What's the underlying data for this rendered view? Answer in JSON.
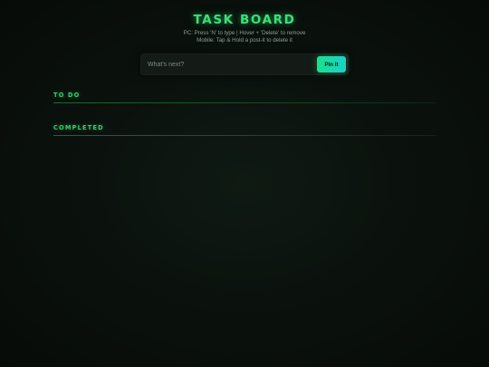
{
  "header": {
    "title": "TASK BOARD",
    "help_line_1": "PC: Press 'N' to type | Hover + 'Delete' to remove",
    "help_line_2": "Mobile: Tap & Hold a post-it to delete it"
  },
  "composer": {
    "placeholder": "What's next?",
    "value": "",
    "pin_label": "Pin It"
  },
  "sections": [
    {
      "title": "TO DO",
      "items": []
    },
    {
      "title": "COMPLETED",
      "items": []
    }
  ],
  "colors": {
    "accent": "#3be07a",
    "button_start": "#19e08e",
    "button_end": "#1ad1c8",
    "background": "#0b120d"
  }
}
